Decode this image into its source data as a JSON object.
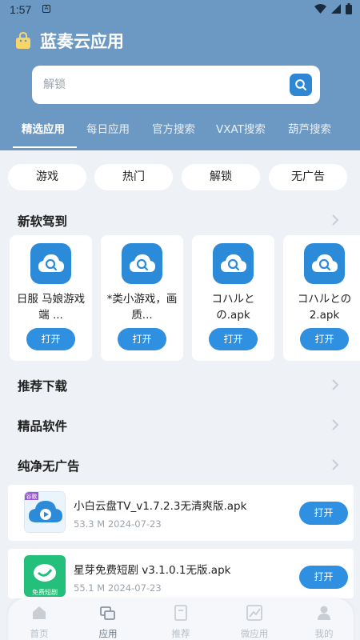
{
  "status_bar": {
    "time": "1:57",
    "notif_glyph": "A",
    "icons": [
      "wifi-icon",
      "signal-icon",
      "battery-icon"
    ]
  },
  "header": {
    "title": "蓝奏云应用",
    "logo_icon": "shopping-bag-icon",
    "background": "#6b99c3"
  },
  "search": {
    "placeholder": "解锁",
    "value": "",
    "icon": "search-icon"
  },
  "tabs": [
    {
      "label": "精选应用",
      "active": true
    },
    {
      "label": "每日应用",
      "active": false
    },
    {
      "label": "官方搜索",
      "active": false
    },
    {
      "label": "VXAT搜索",
      "active": false
    },
    {
      "label": "葫芦搜索",
      "active": false
    }
  ],
  "chips": [
    "游戏",
    "热门",
    "解锁",
    "无广告"
  ],
  "sections": {
    "new_arrivals": "新软驾到",
    "recommended": "推荐下载",
    "premium": "精品软件",
    "ad_free": "纯净无广告"
  },
  "new_apps": [
    {
      "name": "日服 马娘游戏端 ...",
      "button": "打开"
    },
    {
      "name": "*类小游戏，画质...",
      "button": "打开"
    },
    {
      "name": "コハルとの.apk",
      "button": "打开"
    },
    {
      "name": "コハルとの2.apk",
      "button": "打开"
    }
  ],
  "ad_free_list": [
    {
      "name": "小白云盘TV_v1.7.2.3无清爽版.apk",
      "size": "53.3 M",
      "date": "2024-07-23",
      "button": "打开",
      "thumb_label": "谷歌"
    },
    {
      "name": "星芽免费短剧 v3.1.0.1无版.apk",
      "size": "55.1 M",
      "date": "2024-07-23",
      "button": "打开",
      "thumb_label": "免费短剧"
    }
  ],
  "bottom_nav": [
    {
      "label": "首页",
      "icon": "home-icon",
      "active": false
    },
    {
      "label": "应用",
      "icon": "apps-icon",
      "active": true
    },
    {
      "label": "推荐",
      "icon": "book-icon",
      "active": false
    },
    {
      "label": "微应用",
      "icon": "chart-icon",
      "active": false
    },
    {
      "label": "我的",
      "icon": "user-icon",
      "active": false
    }
  ],
  "colors": {
    "accent": "#2f8fe0",
    "header": "#6b99c3",
    "background": "#eef1f5"
  }
}
